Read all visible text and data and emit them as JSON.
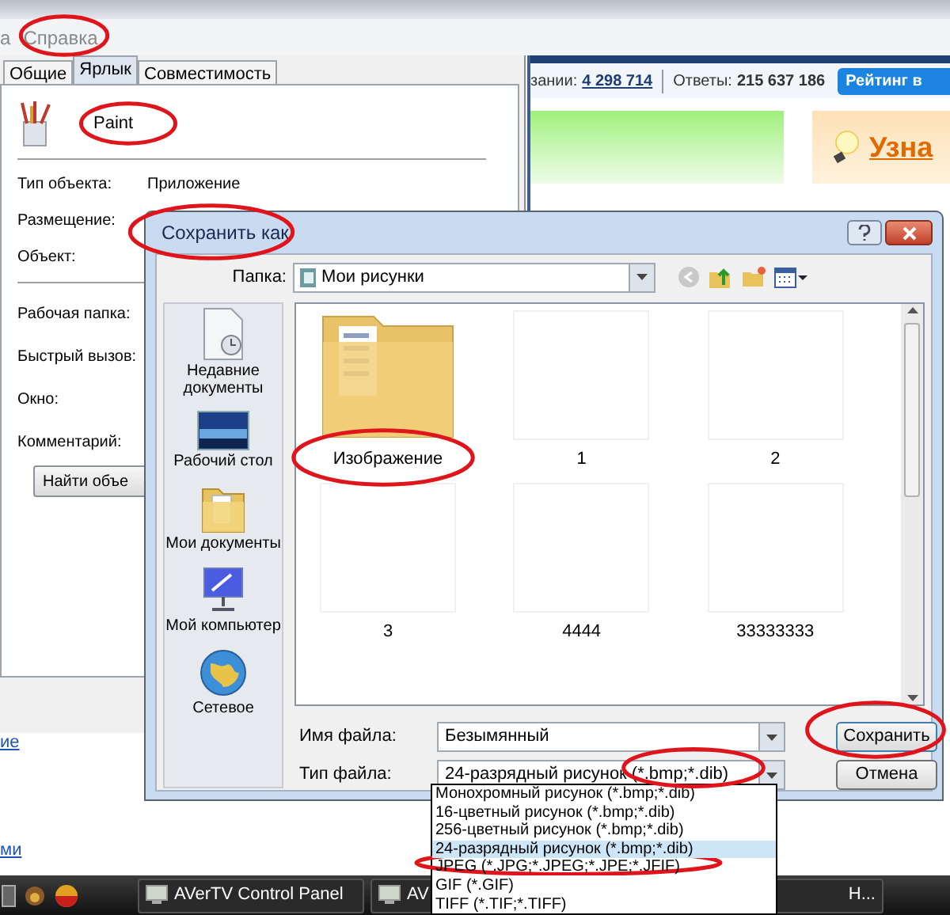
{
  "menu": {
    "items": [
      "а",
      "Справка"
    ]
  },
  "properties": {
    "tabs": [
      {
        "label": "Общие",
        "selected": false
      },
      {
        "label": "Ярлык",
        "selected": true
      },
      {
        "label": "Совместимость",
        "selected": false
      }
    ],
    "name": "Paint",
    "fields_top": [
      {
        "label": "Тип объекта:",
        "value": "Приложение"
      },
      {
        "label": "Размещение:"
      },
      {
        "label": "Объект:"
      }
    ],
    "fields_bottom": [
      {
        "label": "Рабочая папка:"
      },
      {
        "label": "Быстрый вызов:"
      },
      {
        "label": "Окно:"
      },
      {
        "label": "Комментарий:"
      }
    ],
    "button": "Найти объе"
  },
  "web": {
    "stats": [
      {
        "label": "зании:",
        "value": "4 298 714",
        "link": true
      },
      {
        "label": "Ответы:",
        "value": "215 637 186",
        "link": false
      }
    ],
    "rating_button": "Рейтинг в",
    "banner_text": "Узна",
    "links": [
      "ие",
      "ми"
    ]
  },
  "dialog": {
    "title": "Сохранить как",
    "folder_label": "Папка:",
    "folder": "Мои рисунки",
    "places": [
      {
        "label": "Недавние документы",
        "kind": "recent"
      },
      {
        "label": "Рабочий стол",
        "kind": "desktop"
      },
      {
        "label": "Мои документы",
        "kind": "documents"
      },
      {
        "label": "Мой компьютер",
        "kind": "computer"
      },
      {
        "label": "Сетевое",
        "kind": "network"
      }
    ],
    "files": [
      {
        "name": "Изображение",
        "kind": "folder"
      },
      {
        "name": "1",
        "kind": "image"
      },
      {
        "name": "2",
        "kind": "image"
      },
      {
        "name": "3",
        "kind": "image"
      },
      {
        "name": "4444",
        "kind": "image"
      },
      {
        "name": "33333333",
        "kind": "image"
      }
    ],
    "filename_label": "Имя файла:",
    "filename": "Безымянный",
    "filetype_label": "Тип файла:",
    "filetype": "24-разрядный рисунок (*.bmp;*.dib)",
    "buttons": [
      "Сохранить",
      "Отмена"
    ],
    "filetype_options": [
      {
        "label": "Монохромный рисунок (*.bmp;*.dib)",
        "selected": false
      },
      {
        "label": "16-цветный рисунок (*.bmp;*.dib)",
        "selected": false
      },
      {
        "label": "256-цветный рисунок (*.bmp;*.dib)",
        "selected": false
      },
      {
        "label": "24-разрядный рисунок (*.bmp;*.dib)",
        "selected": true
      },
      {
        "label": "JPEG (*.JPG;*.JPEG;*.JPE;*.JFIF)",
        "selected": false
      },
      {
        "label": "GIF (*.GIF)",
        "selected": false
      },
      {
        "label": "TIFF (*.TIF;*.TIFF)",
        "selected": false
      }
    ]
  },
  "taskbar": {
    "items": [
      "AVerTV Control Panel",
      "AV",
      "Н..."
    ]
  }
}
